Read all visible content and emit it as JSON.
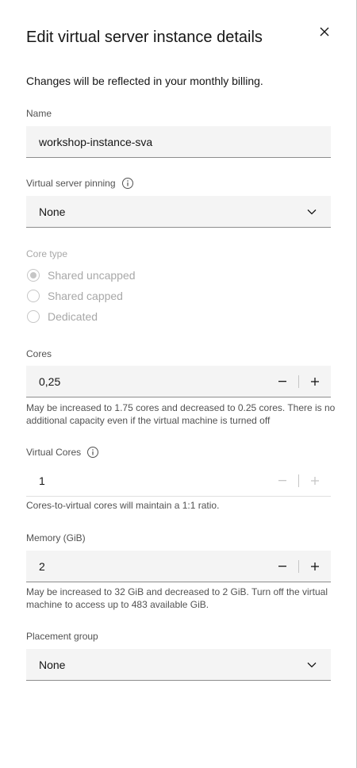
{
  "modal": {
    "title": "Edit virtual server instance details",
    "description": "Changes will be reflected in your monthly billing."
  },
  "name": {
    "label": "Name",
    "value": "workshop-instance-sva"
  },
  "pinning": {
    "label": "Virtual server pinning",
    "value": "None"
  },
  "core_type": {
    "label": "Core type",
    "options": [
      "Shared uncapped",
      "Shared capped",
      "Dedicated"
    ],
    "selected": "Shared uncapped"
  },
  "cores": {
    "label": "Cores",
    "value": "0,25",
    "helper": "May be increased to 1.75 cores and decreased to 0.25 cores. There is no additional capacity even if the virtual machine is turned off"
  },
  "virtual_cores": {
    "label": "Virtual Cores",
    "value": "1",
    "helper": "Cores-to-virtual cores will maintain a 1:1 ratio."
  },
  "memory": {
    "label": "Memory (GiB)",
    "value": "2",
    "helper": "May be increased to 32 GiB and decreased to 2 GiB. Turn off the virtual machine to access up to 483 available GiB."
  },
  "placement": {
    "label": "Placement group",
    "value": "None"
  },
  "icons": {
    "close": "close-icon",
    "info": "info-icon",
    "chevron": "chevron-down-icon",
    "minus": "minus-icon",
    "plus": "plus-icon"
  },
  "colors": {
    "field_bg": "#f4f4f4",
    "text": "#161616",
    "muted": "#525252",
    "disabled": "#a8a8a8"
  }
}
